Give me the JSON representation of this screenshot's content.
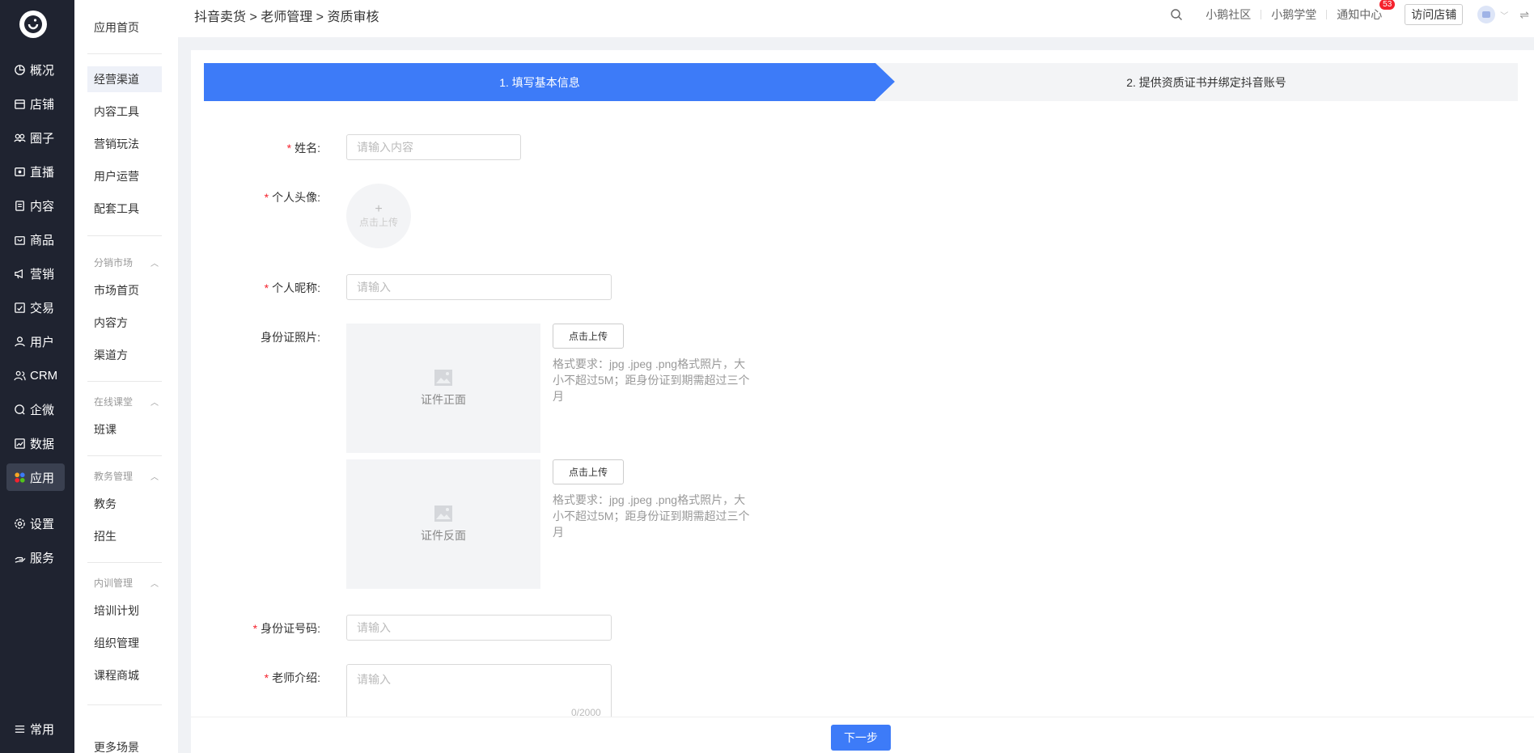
{
  "nav": {
    "items": [
      {
        "label": "概况",
        "icon": "pie-chart-icon"
      },
      {
        "label": "店铺",
        "icon": "store-icon"
      },
      {
        "label": "圈子",
        "icon": "group-icon"
      },
      {
        "label": "直播",
        "icon": "live-icon"
      },
      {
        "label": "内容",
        "icon": "document-icon"
      },
      {
        "label": "商品",
        "icon": "bag-icon"
      },
      {
        "label": "营销",
        "icon": "megaphone-icon"
      },
      {
        "label": "交易",
        "icon": "trade-icon"
      },
      {
        "label": "用户",
        "icon": "user-icon"
      },
      {
        "label": "CRM",
        "icon": "crm-icon"
      },
      {
        "label": "企微",
        "icon": "wecom-icon"
      },
      {
        "label": "数据",
        "icon": "data-icon"
      },
      {
        "label": "应用",
        "icon": "apps-icon"
      },
      {
        "label": "设置",
        "icon": "settings-icon"
      },
      {
        "label": "服务",
        "icon": "service-icon"
      }
    ],
    "bottom": {
      "label": "常用",
      "icon": "list-icon"
    }
  },
  "sub": {
    "home": "应用首页",
    "items1": [
      "经营渠道",
      "内容工具",
      "营销玩法",
      "用户运营",
      "配套工具"
    ],
    "group_market": "分销市场",
    "items2": [
      "市场首页",
      "内容方",
      "渠道方"
    ],
    "group_online": "在线课堂",
    "items3": [
      "班课"
    ],
    "group_edu": "教务管理",
    "items4": [
      "教务",
      "招生"
    ],
    "group_train": "内训管理",
    "items5": [
      "培训计划",
      "组织管理",
      "课程商城"
    ],
    "more": "更多场景"
  },
  "topbar": {
    "breadcrumb": "抖音卖货 > 老师管理 > 资质审核",
    "links": [
      "小鹅社区",
      "小鹅学堂"
    ],
    "notify": "通知中心",
    "notify_count": "53",
    "visit": "访问店铺"
  },
  "steps": {
    "step1": "1. 填写基本信息",
    "step2": "2. 提供资质证书并绑定抖音账号"
  },
  "form": {
    "name_label": "姓名:",
    "name_placeholder": "请输入内容",
    "avatar_label": "个人头像:",
    "avatar_upload": "点击上传",
    "nickname_label": "个人昵称:",
    "nickname_placeholder": "请输入",
    "idphoto_label": "身份证照片:",
    "id_front": "证件正面",
    "id_back": "证件反面",
    "upload_btn": "点击上传",
    "hint": "格式要求：jpg .jpeg .png格式照片，大小不超过5M；距身份证到期需超过三个月",
    "idnum_label": "身份证号码:",
    "idnum_placeholder": "请输入",
    "intro_label": "老师介绍:",
    "intro_placeholder": "请输入",
    "intro_counter": "0/2000"
  },
  "footer": {
    "next": "下一步"
  }
}
